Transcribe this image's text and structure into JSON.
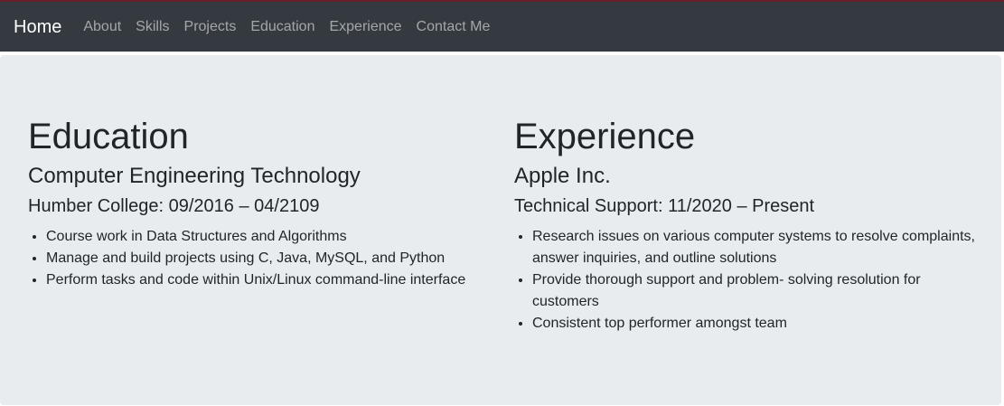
{
  "navbar": {
    "brand": "Home",
    "links": [
      "About",
      "Skills",
      "Projects",
      "Education",
      "Experience",
      "Contact Me"
    ]
  },
  "education": {
    "heading": "Education",
    "program": "Computer Engineering Technology",
    "school": "Humber College: 09/2016 – 04/2109",
    "items": [
      "Course work in Data Structures and Algorithms",
      "Manage and build projects using C, Java, MySQL, and Python",
      "Perform tasks and code within Unix/Linux command-line interface"
    ]
  },
  "experience": {
    "heading": "Experience",
    "company": "Apple Inc.",
    "role": "Technical Support: 11/2020 – Present",
    "items": [
      "Research issues on various computer systems to resolve complaints, answer inquiries, and outline solutions",
      "Provide thorough support and problem- solving resolution for customers",
      "Consistent top performer amongst team"
    ]
  },
  "colors": {
    "navbar_bg": "#343a40",
    "jumbotron_bg": "#e9ecef",
    "accent_top": "#6b1e2c"
  }
}
